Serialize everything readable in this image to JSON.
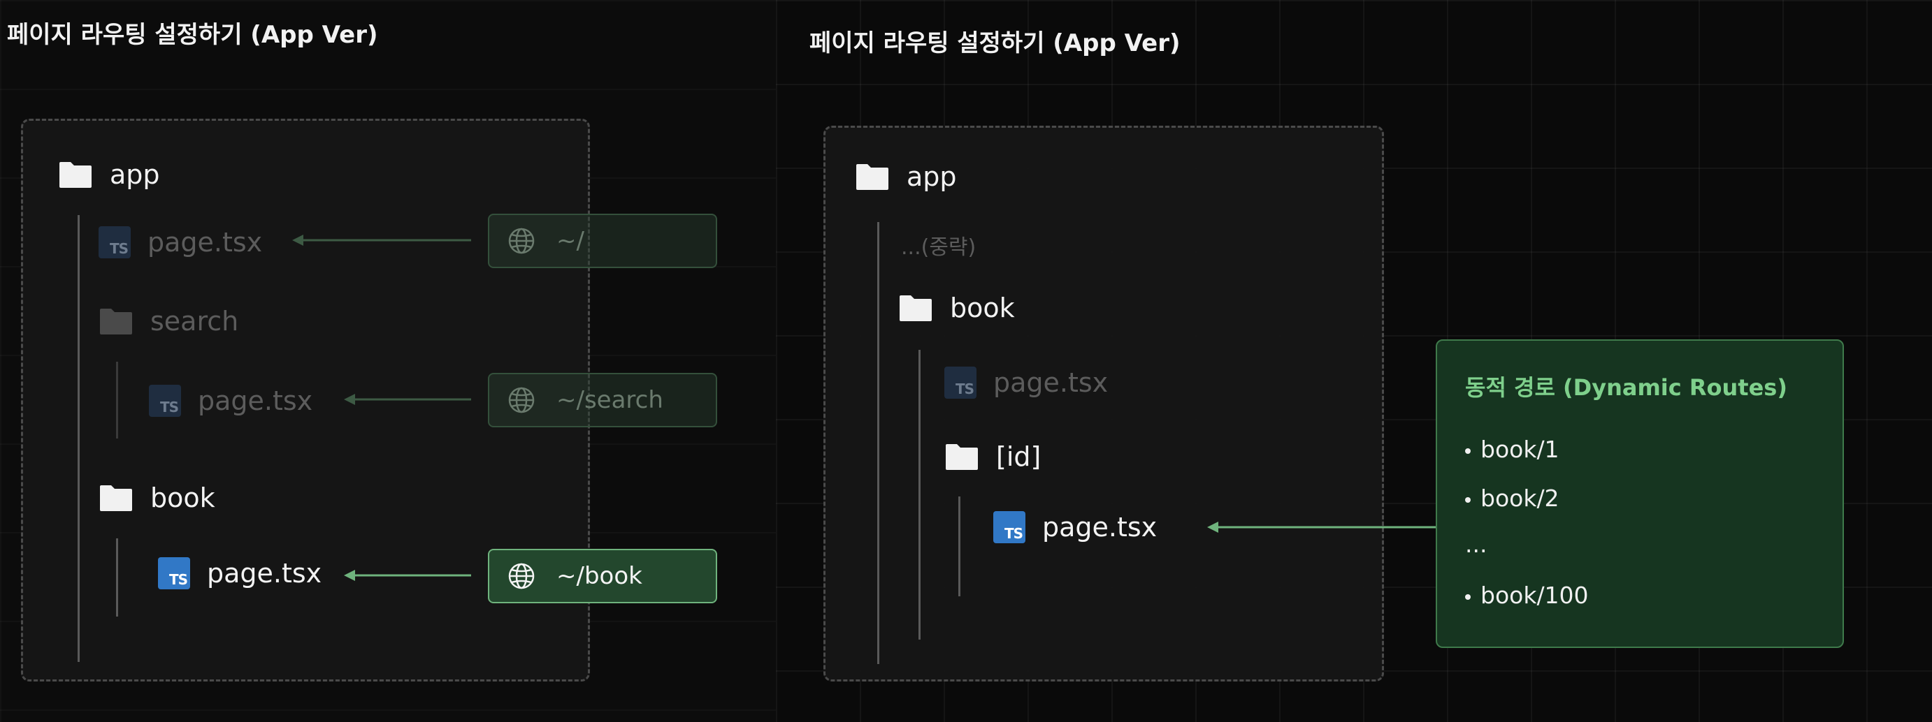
{
  "left": {
    "title": "페이지 라우팅 설정하기 (App Ver)",
    "tree": {
      "app": "app",
      "root_page": "page.tsx",
      "search": "search",
      "search_page": "page.tsx",
      "book": "book",
      "book_page": "page.tsx"
    },
    "routes": {
      "root": "~/",
      "search": "~/search",
      "book": "~/book"
    }
  },
  "right": {
    "title": "페이지 라우팅 설정하기 (App Ver)",
    "tree": {
      "app": "app",
      "omitted": "...(중략)",
      "book": "book",
      "book_page": "page.tsx",
      "id_folder": "[id]",
      "id_page": "page.tsx"
    },
    "info": {
      "title": "동적 경로 (Dynamic Routes)",
      "items": [
        "book/1",
        "book/2",
        "...",
        "book/100"
      ]
    }
  },
  "icons": {
    "folder": "folder-icon",
    "typescript": "typescript-file-icon",
    "globe": "globe-icon",
    "arrow": "arrow-left-icon"
  },
  "colors": {
    "accent_green": "#6fb37d",
    "ts_blue": "#3178c6"
  }
}
